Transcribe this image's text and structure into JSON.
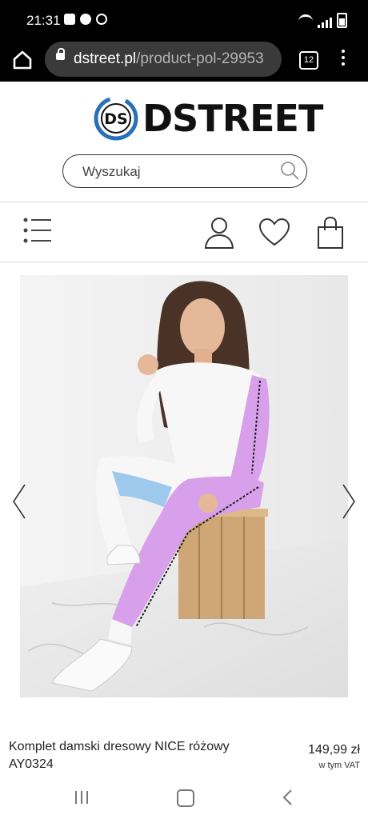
{
  "status_bar": {
    "time": "21:31"
  },
  "browser": {
    "url_domain": "dstreet.pl",
    "url_path": "/product-pol-29953",
    "tab_count": "12"
  },
  "logo": {
    "text": "DSTREET",
    "mark": "DS"
  },
  "search": {
    "placeholder": "Wyszukaj"
  },
  "nav": {
    "icons": [
      "menu-icon",
      "user-icon",
      "heart-icon",
      "bag-icon"
    ]
  },
  "product": {
    "name": "Komplet damski dresowy NICE różowy AY0324",
    "price": "149,99 zł",
    "vat_note": "w tym VAT"
  },
  "colors": {
    "topbar": "#000000",
    "url_box": "#3a3a3a",
    "logo_blue": "#2a6fb8",
    "pants_lilac": "#d8a0ea",
    "leg_blue": "#9fc9ec"
  }
}
